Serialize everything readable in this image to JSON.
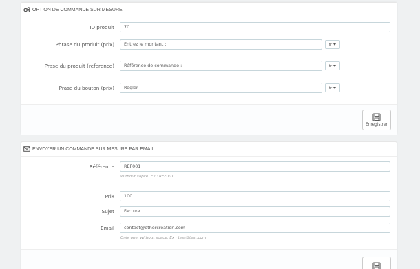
{
  "panel1": {
    "title": "OPTION DE COMMANDE SUR MESURE",
    "icon": "cogs-icon",
    "fields": {
      "id_produit": {
        "label": "ID produit",
        "value": "70"
      },
      "phrase_prix": {
        "label": "Phrase du produit (prix)",
        "value": "Entrez le montant :",
        "lang": "fr"
      },
      "phrase_ref": {
        "label": "Prase du produit (reference)",
        "value": "Référence de commande :",
        "lang": "fr"
      },
      "phrase_bouton": {
        "label": "Prase du bouton (prix)",
        "value": "Régler",
        "lang": "fr"
      }
    },
    "save_label": "Enregistrer"
  },
  "panel2": {
    "title": "ENVOYER UN COMMANDE SUR MESURE PAR EMAIL",
    "icon": "envelope-icon",
    "fields": {
      "reference": {
        "label": "Référence",
        "value": "REF001",
        "help": "Without sapce. Ex : REF001"
      },
      "prix": {
        "label": "Prix",
        "value": "100"
      },
      "sujet": {
        "label": "Sujet",
        "value": "Facture"
      },
      "email": {
        "label": "Email",
        "value": "contact@ethercreation.com",
        "help": "Only one, without space. Ex : test@test.com"
      }
    }
  }
}
